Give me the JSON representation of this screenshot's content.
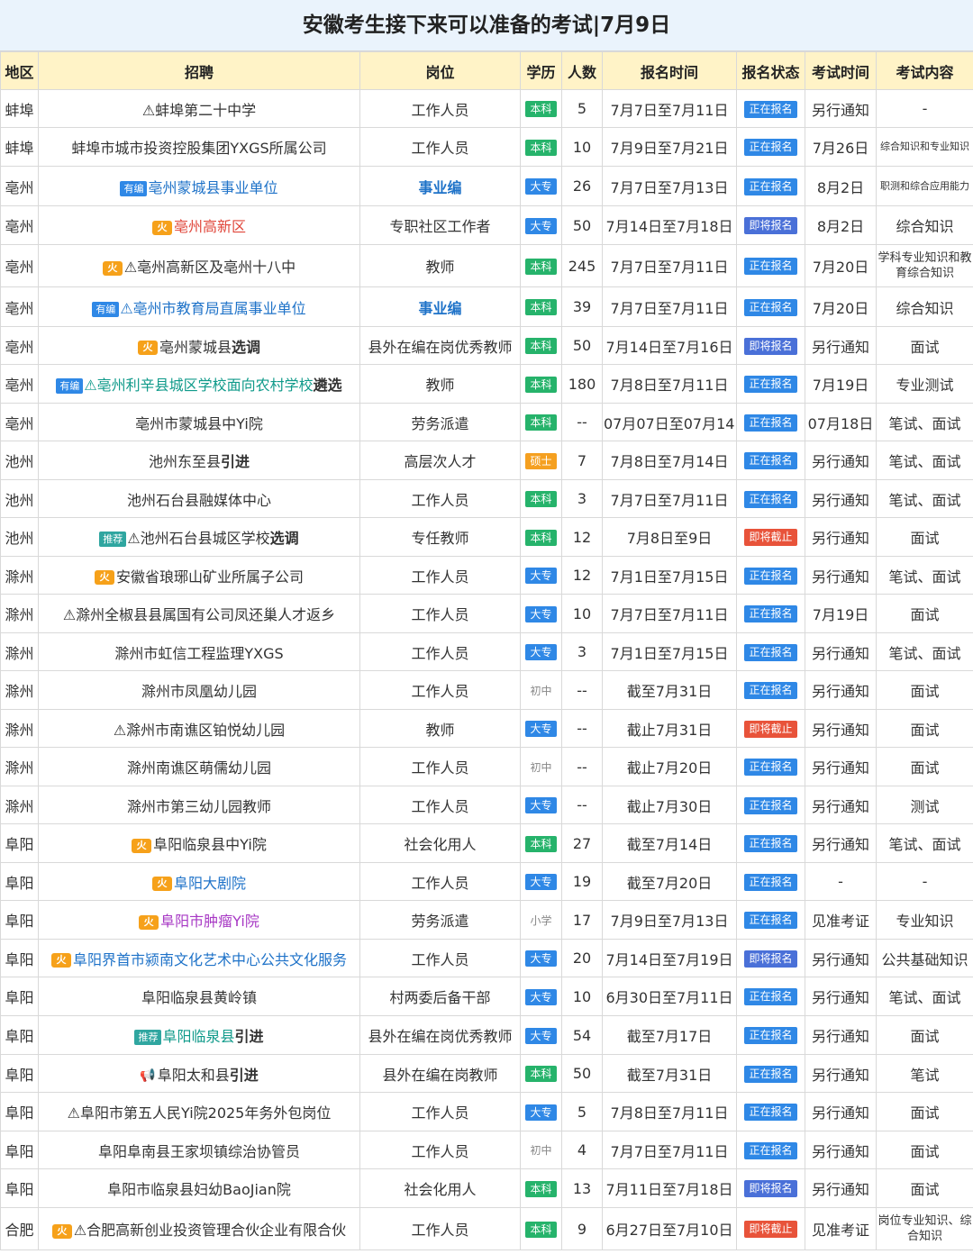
{
  "title": "安徽考生接下来可以准备的考试|7月9日",
  "columns": [
    "地区",
    "招聘",
    "岗位",
    "学历",
    "人数",
    "报名时间",
    "报名状态",
    "考试时间",
    "考试内容"
  ],
  "rows": [
    {
      "region": "蚌埠",
      "prefix": "⚠",
      "recruit": "蚌埠第二十中学",
      "post": "工作人员",
      "edu": "本科",
      "num": "5",
      "date": "7月7日至7月11日",
      "status": "正在报名",
      "exam": "另行通知",
      "content": "-"
    },
    {
      "region": "蚌埠",
      "recruit": "蚌埠市城市投资控股集团YXGS所属公司",
      "post": "工作人员",
      "edu": "本科",
      "num": "10",
      "date": "7月9日至7月21日",
      "status": "正在报名",
      "exam": "7月26日",
      "content": "综合知识和专业知识"
    },
    {
      "region": "亳州",
      "tag": "有编",
      "recruit": "亳州蒙城县事业单位",
      "post": "事业编",
      "edu": "大专",
      "num": "26",
      "date": "7月7日至7月13日",
      "status": "正在报名",
      "exam": "8月2日",
      "content": "职测和综合应用能力"
    },
    {
      "region": "亳州",
      "hot": "火",
      "recruit": "亳州高新区",
      "post": "专职社区工作者",
      "edu": "大专",
      "num": "50",
      "date": "7月14日至7月18日",
      "status": "即将报名",
      "exam": "8月2日",
      "content": "综合知识"
    },
    {
      "region": "亳州",
      "hot": "火",
      "prefix": "⚠",
      "recruit": "亳州高新区及亳州十八中",
      "post": "教师",
      "edu": "本科",
      "num": "245",
      "date": "7月7日至7月11日",
      "status": "正在报名",
      "exam": "7月20日",
      "content": "学科专业知识和教育综合知识"
    },
    {
      "region": "亳州",
      "tag": "有编",
      "prefix": "⚠",
      "recruit": "亳州市教育局直属事业单位",
      "post": "事业编",
      "edu": "本科",
      "num": "39",
      "date": "7月7日至7月11日",
      "status": "正在报名",
      "exam": "7月20日",
      "content": "综合知识"
    },
    {
      "region": "亳州",
      "hot": "火",
      "recruit": "亳州蒙城县",
      "recruit_bold": "选调",
      "post": "县外在编在岗优秀教师",
      "edu": "本科",
      "num": "50",
      "date": "7月14日至7月16日",
      "status": "即将报名",
      "exam": "另行通知",
      "content": "面试"
    },
    {
      "region": "亳州",
      "tag": "有编",
      "prefix": "⚠",
      "recruit": "亳州利辛县城区学校面向农村学校",
      "recruit_bold": "遴选",
      "post": "教师",
      "edu": "本科",
      "num": "180",
      "date": "7月8日至7月11日",
      "status": "正在报名",
      "exam": "7月19日",
      "content": "专业测试"
    },
    {
      "region": "亳州",
      "recruit": "亳州市蒙城县中Yi院",
      "post": "劳务派遣",
      "edu": "本科",
      "num": "--",
      "date": "07月07日至07月14日",
      "status": "正在报名",
      "exam": "07月18日",
      "content": "笔试、面试"
    },
    {
      "region": "池州",
      "recruit": "池州东至县",
      "recruit_bold": "引进",
      "post": "高层次人才",
      "edu": "硕士",
      "num": "7",
      "date": "7月8日至7月14日",
      "status": "正在报名",
      "exam": "另行通知",
      "content": "笔试、面试"
    },
    {
      "region": "池州",
      "recruit": "池州石台县融媒体中心",
      "post": "工作人员",
      "edu": "本科",
      "num": "3",
      "date": "7月7日至7月11日",
      "status": "正在报名",
      "exam": "另行通知",
      "content": "笔试、面试"
    },
    {
      "region": "池州",
      "tag": "推荐",
      "prefix": "⚠",
      "recruit": "池州石台县城区学校",
      "recruit_bold": "选调",
      "post": "专任教师",
      "edu": "本科",
      "num": "12",
      "date": "7月8日至9日",
      "status": "即将截止",
      "exam": "另行通知",
      "content": "面试"
    },
    {
      "region": "滁州",
      "hot": "火",
      "recruit": "安徽省琅琊山矿业所属子公司",
      "post": "工作人员",
      "edu": "大专",
      "num": "12",
      "date": "7月1日至7月15日",
      "status": "正在报名",
      "exam": "另行通知",
      "content": "笔试、面试"
    },
    {
      "region": "滁州",
      "prefix": "⚠",
      "recruit": "滁州全椒县县属国有公司凤还巢人才返乡",
      "post": "工作人员",
      "edu": "大专",
      "num": "10",
      "date": "7月7日至7月11日",
      "status": "正在报名",
      "exam": "7月19日",
      "content": "面试"
    },
    {
      "region": "滁州",
      "recruit": "滁州市虹信工程监理YXGS",
      "post": "工作人员",
      "edu": "大专",
      "num": "3",
      "date": "7月1日至7月15日",
      "status": "正在报名",
      "exam": "另行通知",
      "content": "笔试、面试"
    },
    {
      "region": "滁州",
      "recruit": "滁州市凤凰幼儿园",
      "post": "工作人员",
      "edu": "初中",
      "num": "--",
      "date": "截至7月31日",
      "status": "正在报名",
      "exam": "另行通知",
      "content": "面试"
    },
    {
      "region": "滁州",
      "prefix": "⚠",
      "recruit": "滁州市南谯区铂悦幼儿园",
      "post": "教师",
      "edu": "大专",
      "num": "--",
      "date": "截止7月31日",
      "status": "即将截止",
      "exam": "另行通知",
      "content": "面试"
    },
    {
      "region": "滁州",
      "recruit": "滁州南谯区萌儒幼儿园",
      "post": "工作人员",
      "edu": "初中",
      "num": "--",
      "date": "截止7月20日",
      "status": "正在报名",
      "exam": "另行通知",
      "content": "面试"
    },
    {
      "region": "滁州",
      "recruit": "滁州市第三幼儿园教师",
      "post": "工作人员",
      "edu": "大专",
      "num": "--",
      "date": "截止7月30日",
      "status": "正在报名",
      "exam": "另行通知",
      "content": "测试"
    },
    {
      "region": "阜阳",
      "hot": "火",
      "recruit": "阜阳临泉县中Yi院",
      "post": "社会化用人",
      "edu": "本科",
      "num": "27",
      "date": "截至7月14日",
      "status": "正在报名",
      "exam": "另行通知",
      "content": "笔试、面试"
    },
    {
      "region": "阜阳",
      "hot": "火",
      "recruit": "阜阳大剧院",
      "post": "工作人员",
      "edu": "大专",
      "num": "19",
      "date": "截至7月20日",
      "status": "正在报名",
      "exam": "-",
      "content": "-"
    },
    {
      "region": "阜阳",
      "hot": "火",
      "recruit": "阜阳市肿瘤Yi院",
      "post": "劳务派遣",
      "edu": "小学",
      "num": "17",
      "date": "7月9日至7月13日",
      "status": "正在报名",
      "exam": "见准考证",
      "content": "专业知识"
    },
    {
      "region": "阜阳",
      "hot": "火",
      "recruit": "阜阳界首市颍南文化艺术中心公共文化服务",
      "post": "工作人员",
      "edu": "大专",
      "num": "20",
      "date": "7月14日至7月19日",
      "status": "即将报名",
      "exam": "另行通知",
      "content": "公共基础知识"
    },
    {
      "region": "阜阳",
      "recruit": "阜阳临泉县黄岭镇",
      "post": "村两委后备干部",
      "edu": "大专",
      "num": "10",
      "date": "6月30日至7月11日",
      "status": "正在报名",
      "exam": "另行通知",
      "content": "笔试、面试"
    },
    {
      "region": "阜阳",
      "tag": "推荐",
      "recruit": "阜阳临泉县",
      "recruit_bold": "引进",
      "post": "县外在编在岗优秀教师",
      "edu": "大专",
      "num": "54",
      "date": "截至7月17日",
      "status": "正在报名",
      "exam": "另行通知",
      "content": "面试"
    },
    {
      "region": "阜阳",
      "horn": "📢",
      "recruit": "阜阳太和县",
      "recruit_bold": "引进",
      "post": "县外在编在岗教师",
      "edu": "本科",
      "num": "50",
      "date": "截至7月31日",
      "status": "正在报名",
      "exam": "另行通知",
      "content": "笔试"
    },
    {
      "region": "阜阳",
      "prefix": "⚠",
      "recruit": "阜阳市第五人民Yi院2025年务外包岗位",
      "post": "工作人员",
      "edu": "大专",
      "num": "5",
      "date": "7月8日至7月11日",
      "status": "正在报名",
      "exam": "另行通知",
      "content": "面试"
    },
    {
      "region": "阜阳",
      "recruit": "阜阳阜南县王家坝镇综治协管员",
      "post": "工作人员",
      "edu": "初中",
      "num": "4",
      "date": "7月7日至7月11日",
      "status": "正在报名",
      "exam": "另行通知",
      "content": "面试"
    },
    {
      "region": "阜阳",
      "recruit": "阜阳市临泉县妇幼BaoJian院",
      "post": "社会化用人",
      "edu": "本科",
      "num": "13",
      "date": "7月11日至7月18日",
      "status": "即将报名",
      "exam": "另行通知",
      "content": "面试"
    },
    {
      "region": "合肥",
      "hot": "火",
      "prefix": "⚠",
      "recruit": "合肥高新创业投资管理合伙企业有限合伙",
      "post": "工作人员",
      "edu": "本科",
      "num": "9",
      "date": "6月27日至7月10日",
      "status": "即将截止",
      "exam": "见准考证",
      "content": "岗位专业知识、综合知识"
    }
  ]
}
